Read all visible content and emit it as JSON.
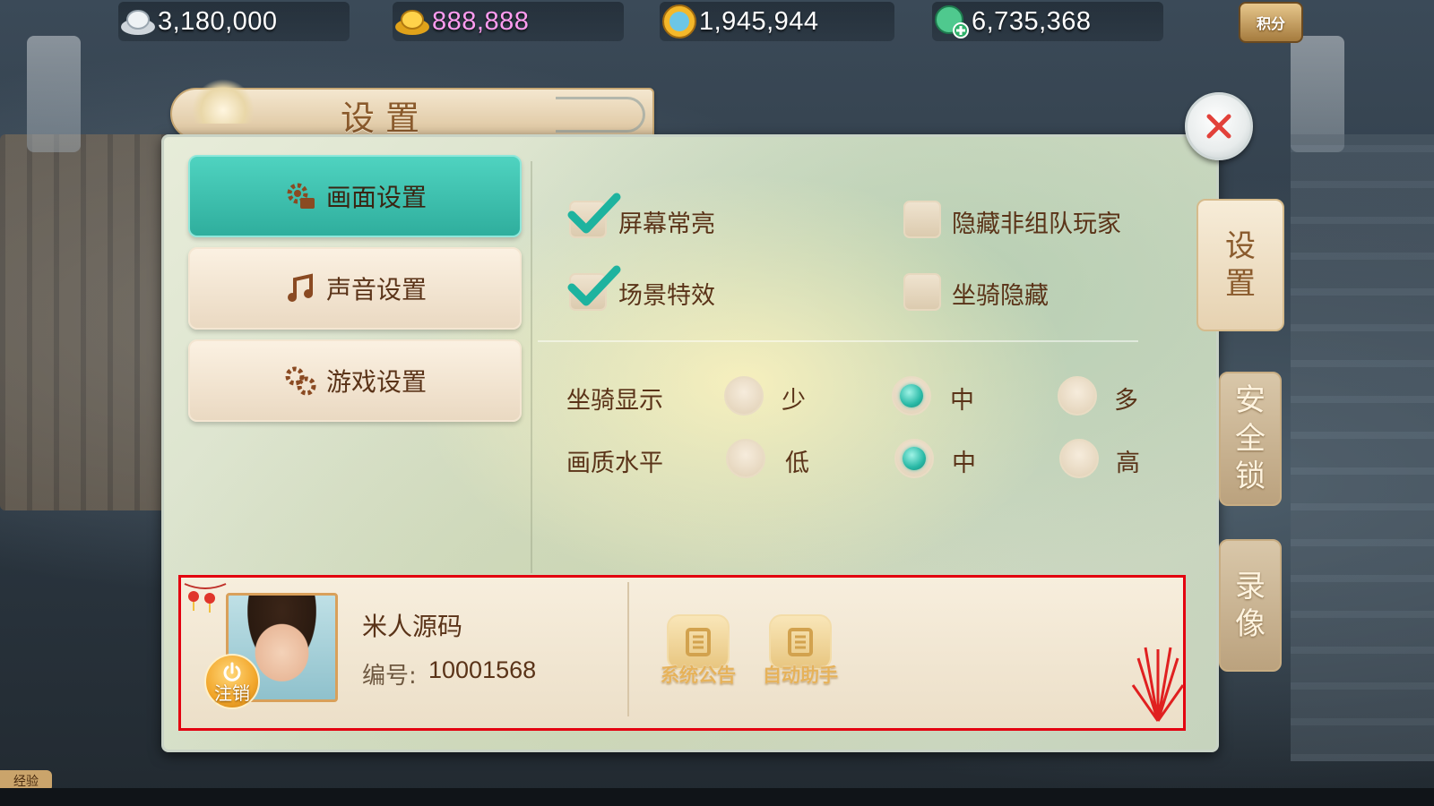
{
  "currencies": [
    {
      "name": "silver-icon",
      "value": "3,180,000",
      "color": "#ffffff"
    },
    {
      "name": "gold-ingot-icon",
      "value": "888,888",
      "color": "#ff9cf0"
    },
    {
      "name": "coin-icon",
      "value": "1,945,944",
      "color": "#ffffff"
    },
    {
      "name": "jade-icon",
      "value": "6,735,368",
      "color": "#ffffff"
    }
  ],
  "points_label": "积分",
  "dialog": {
    "title": "设置"
  },
  "tabs": [
    {
      "label": "画面设置",
      "icon": "gear-icon",
      "active": true
    },
    {
      "label": "声音设置",
      "icon": "music-note-icon",
      "active": false
    },
    {
      "label": "游戏设置",
      "icon": "gears-icon",
      "active": false
    }
  ],
  "checkboxes": [
    {
      "label": "屏幕常亮",
      "checked": true
    },
    {
      "label": "隐藏非组队玩家",
      "checked": false
    },
    {
      "label": "场景特效",
      "checked": true
    },
    {
      "label": "坐骑隐藏",
      "checked": false
    }
  ],
  "radio_groups": [
    {
      "label": "坐骑显示",
      "options": [
        "少",
        "中",
        "多"
      ],
      "selected": "中"
    },
    {
      "label": "画质水平",
      "options": [
        "低",
        "中",
        "高"
      ],
      "selected": "中"
    }
  ],
  "side_tabs": [
    {
      "label_chars": [
        "设",
        "置"
      ],
      "active": true
    },
    {
      "label_chars": [
        "安",
        "全",
        "锁"
      ],
      "active": false
    },
    {
      "label_chars": [
        "录",
        "像"
      ],
      "active": false
    }
  ],
  "player": {
    "name": "米人源码",
    "id_label": "编号:",
    "id_value": "10001568",
    "logout_label": "注销"
  },
  "footer_buttons": [
    {
      "label": "系统公告",
      "icon": "scroll-icon"
    },
    {
      "label": "自动助手",
      "icon": "scroll-icon"
    }
  ],
  "exp_tag": "经验",
  "colors": {
    "accent_teal": "#2fae9d",
    "text_brown": "#5a3318",
    "highlight_border": "#e3000f"
  }
}
